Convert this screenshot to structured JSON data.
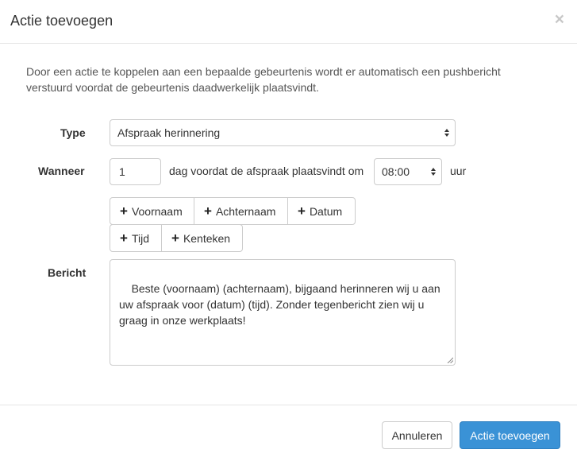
{
  "modal": {
    "title": "Actie toevoegen",
    "close_label": "×",
    "intro": "Door een actie te koppelen aan een bepaalde gebeurtenis wordt er automatisch een pushbericht verstuurd voordat de gebeurtenis daadwerkelijk plaatsvindt."
  },
  "form": {
    "type": {
      "label": "Type",
      "selected": "Afspraak herinnering"
    },
    "wanneer": {
      "label": "Wanneer",
      "days_value": "1",
      "middle_text": "dag voordat de afspraak plaatsvindt om",
      "time_selected": "08:00",
      "unit_text": "uur"
    },
    "placeholders": [
      "Voornaam",
      "Achternaam",
      "Datum",
      "Tijd",
      "Kenteken"
    ],
    "bericht": {
      "label": "Bericht",
      "value": "Beste (voornaam) (achternaam), bijgaand herinneren wij u aan uw afspraak voor (datum) (tijd). Zonder tegenbericht zien wij u graag in onze werkplaats!"
    }
  },
  "footer": {
    "cancel_label": "Annuleren",
    "submit_label": "Actie toevoegen"
  },
  "colors": {
    "primary": "#3a92d6",
    "border": "#cccccc",
    "text": "#333333"
  }
}
